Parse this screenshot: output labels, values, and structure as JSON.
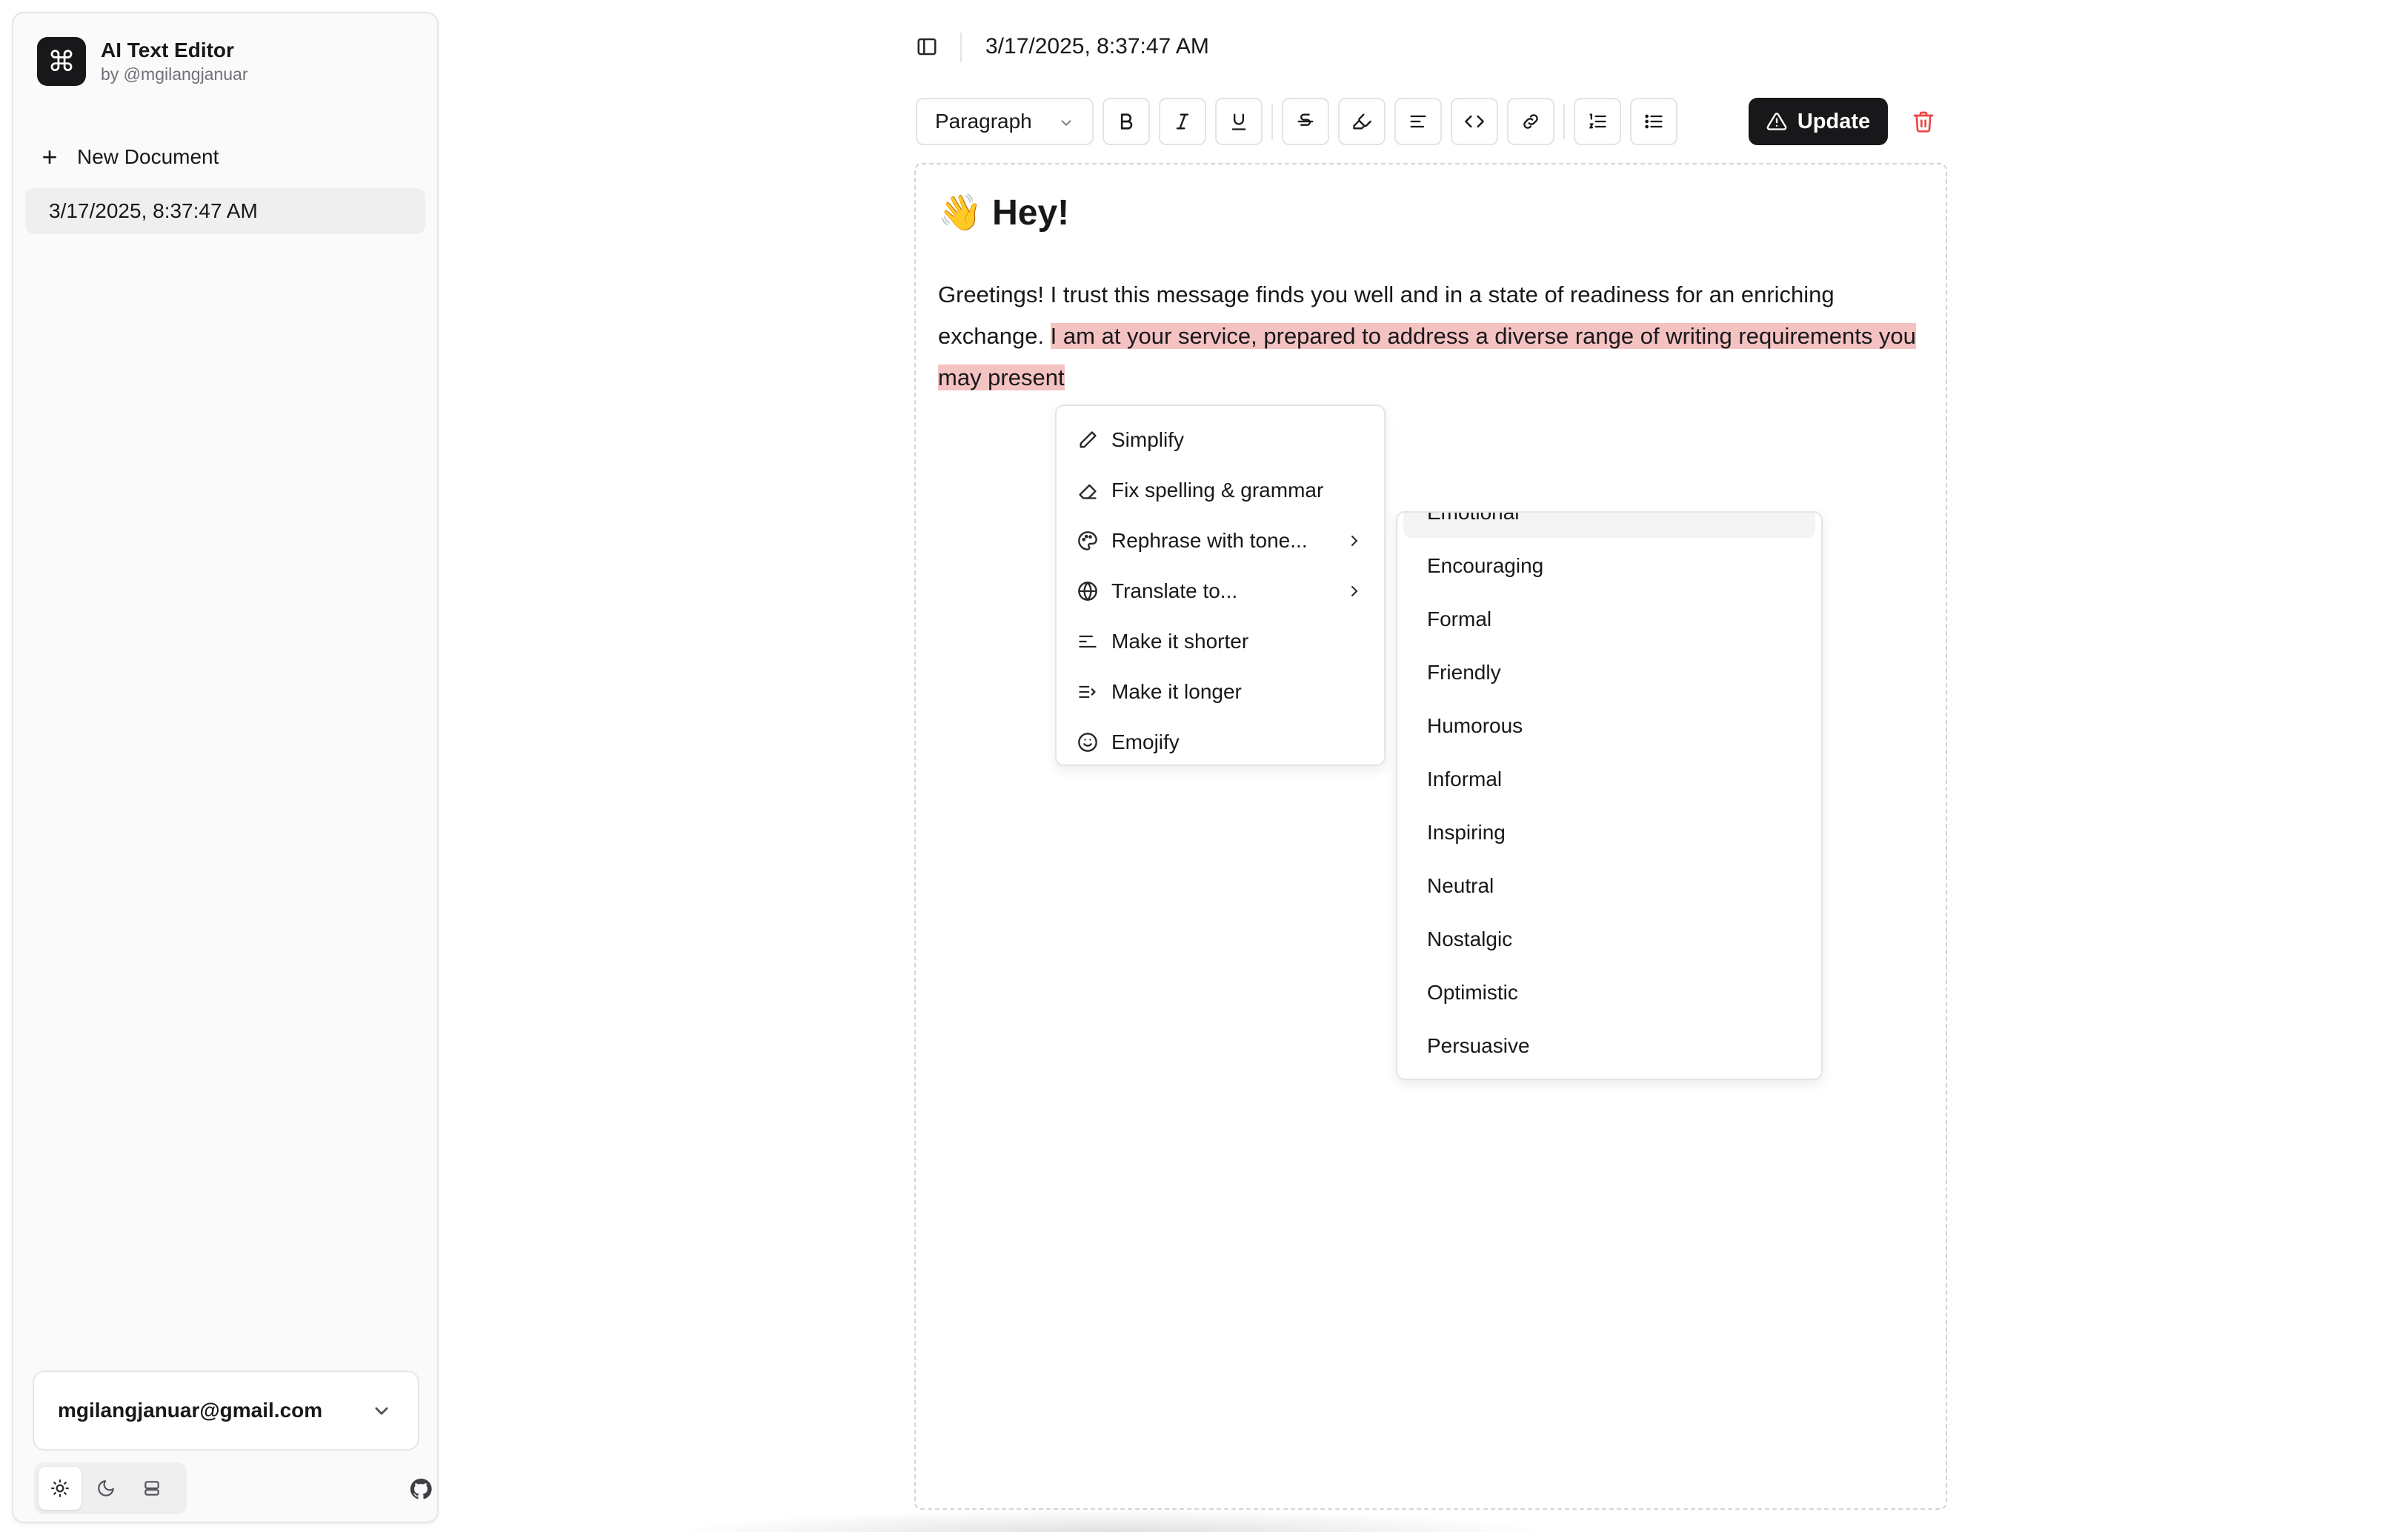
{
  "app": {
    "title": "AI Text Editor",
    "subtitle": "by @mgilangjanuar",
    "logo_icon": "command-icon"
  },
  "sidebar": {
    "new_document_label": "New Document",
    "documents": [
      {
        "label": "3/17/2025, 8:37:47 AM",
        "active": true
      }
    ],
    "account_email": "mgilangjanuar@gmail.com",
    "theme_options": [
      "light",
      "dark",
      "system"
    ],
    "active_theme": "light"
  },
  "header": {
    "document_title": "3/17/2025, 8:37:47 AM"
  },
  "toolbar": {
    "block_type": "Paragraph",
    "buttons": [
      "bold",
      "italic",
      "underline",
      "strikethrough",
      "highlight",
      "align",
      "code",
      "link",
      "ordered-list",
      "bullet-list"
    ],
    "update_label": "Update"
  },
  "editor": {
    "heading_emoji": "👋",
    "heading_text": "Hey!",
    "paragraph_plain": "Greetings! I trust this message finds you well and in a state of readiness for an enriching exchange. ",
    "paragraph_highlight": "I am at your service, prepared to address a diverse range of writing requirements you may present",
    "highlight_color": "#f5c2c2"
  },
  "ai_menu": {
    "items": [
      {
        "label": "Simplify",
        "icon": "pencil-icon",
        "submenu": false
      },
      {
        "label": "Fix spelling & grammar",
        "icon": "eraser-icon",
        "submenu": false
      },
      {
        "label": "Rephrase with tone...",
        "icon": "palette-icon",
        "submenu": true
      },
      {
        "label": "Translate to...",
        "icon": "globe-icon",
        "submenu": true
      },
      {
        "label": "Make it shorter",
        "icon": "shorter-icon",
        "submenu": false
      },
      {
        "label": "Make it longer",
        "icon": "longer-icon",
        "submenu": false
      },
      {
        "label": "Emojify",
        "icon": "smile-icon",
        "submenu": false
      }
    ]
  },
  "tone_menu": {
    "partial_item": "Emotional",
    "items": [
      "Encouraging",
      "Formal",
      "Friendly",
      "Humorous",
      "Informal",
      "Inspiring",
      "Neutral",
      "Nostalgic",
      "Optimistic",
      "Persuasive"
    ]
  }
}
